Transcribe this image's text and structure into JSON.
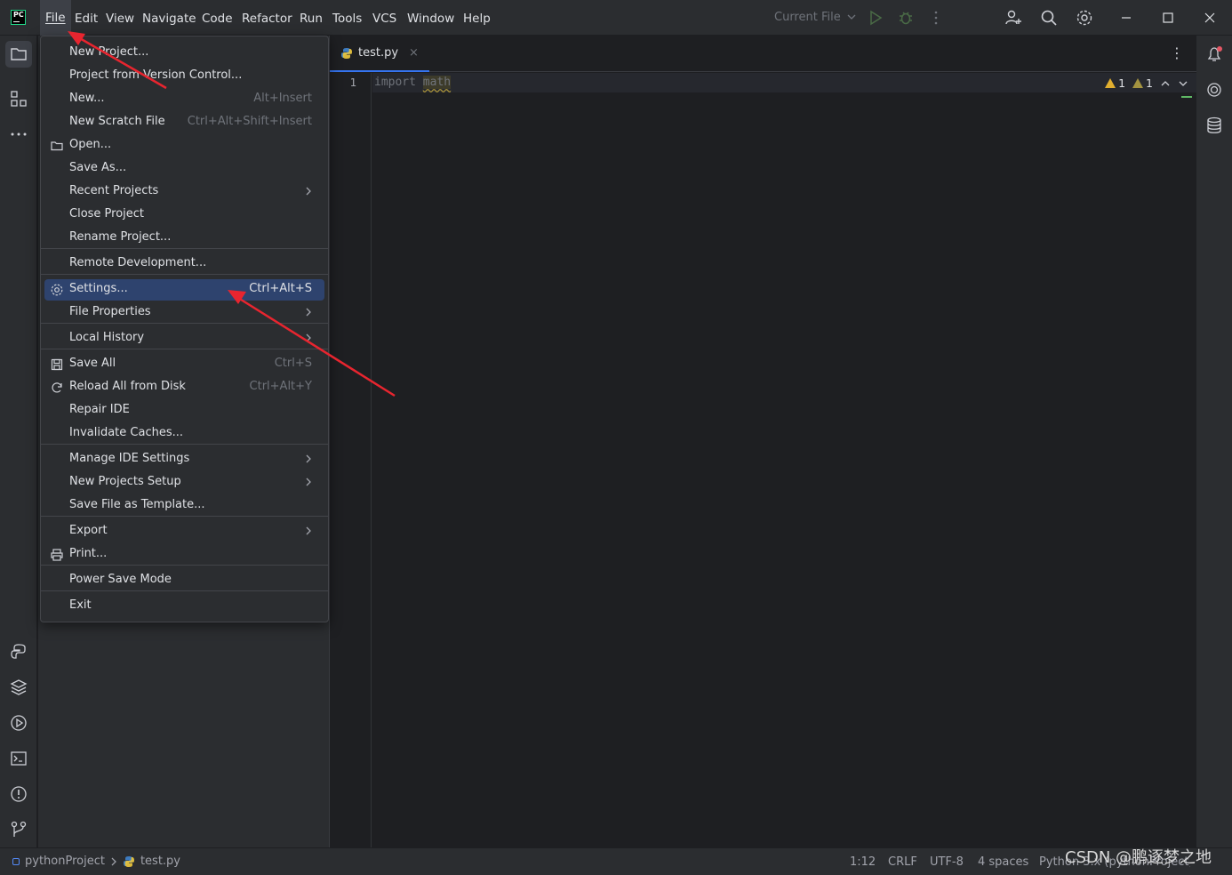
{
  "menubar": {
    "items": [
      {
        "id": "file",
        "label": "File",
        "mnemonic_index": 0
      },
      {
        "id": "edit",
        "label": "Edit"
      },
      {
        "id": "view",
        "label": "View"
      },
      {
        "id": "navigate",
        "label": "Navigate"
      },
      {
        "id": "code",
        "label": "Code"
      },
      {
        "id": "refactor",
        "label": "Refactor"
      },
      {
        "id": "run",
        "label": "Run"
      },
      {
        "id": "tools",
        "label": "Tools"
      },
      {
        "id": "vcs",
        "label": "VCS"
      },
      {
        "id": "window",
        "label": "Window"
      },
      {
        "id": "help",
        "label": "Help"
      }
    ]
  },
  "toolbar": {
    "run_config": "Current File",
    "icons": [
      "run-icon",
      "debug-icon",
      "more-vertical-icon",
      "add-user-icon",
      "search-icon",
      "settings-gear-icon"
    ]
  },
  "window_controls": [
    "minimize-icon",
    "maximize-icon",
    "close-icon"
  ],
  "file_menu": {
    "items": [
      {
        "label": "New Project...",
        "shortcut": "",
        "submenu": false
      },
      {
        "label": "Project from Version Control...",
        "shortcut": "",
        "submenu": false
      },
      {
        "label": "New...",
        "shortcut": "Alt+Insert",
        "submenu": false
      },
      {
        "label": "New Scratch File",
        "shortcut": "Ctrl+Alt+Shift+Insert",
        "submenu": false
      },
      {
        "label": "Open...",
        "shortcut": "",
        "submenu": false,
        "icon": "folder-icon"
      },
      {
        "label": "Save As...",
        "shortcut": "",
        "submenu": false
      },
      {
        "label": "Recent Projects",
        "shortcut": "",
        "submenu": true
      },
      {
        "label": "Close Project",
        "shortcut": "",
        "submenu": false
      },
      {
        "label": "Rename Project...",
        "shortcut": "",
        "submenu": false
      },
      {
        "label": "Remote Development...",
        "shortcut": "",
        "submenu": false
      },
      {
        "label": "Settings...",
        "shortcut": "Ctrl+Alt+S",
        "submenu": false,
        "icon": "gear-icon",
        "selected": true
      },
      {
        "label": "File Properties",
        "shortcut": "",
        "submenu": true
      },
      {
        "label": "Local History",
        "shortcut": "",
        "submenu": true
      },
      {
        "label": "Save All",
        "shortcut": "Ctrl+S",
        "submenu": false,
        "icon": "save-icon"
      },
      {
        "label": "Reload All from Disk",
        "shortcut": "Ctrl+Alt+Y",
        "submenu": false,
        "icon": "reload-icon"
      },
      {
        "label": "Repair IDE",
        "shortcut": "",
        "submenu": false
      },
      {
        "label": "Invalidate Caches...",
        "shortcut": "",
        "submenu": false
      },
      {
        "label": "Manage IDE Settings",
        "shortcut": "",
        "submenu": true
      },
      {
        "label": "New Projects Setup",
        "shortcut": "",
        "submenu": true
      },
      {
        "label": "Save File as Template...",
        "shortcut": "",
        "submenu": false
      },
      {
        "label": "Export",
        "shortcut": "",
        "submenu": true
      },
      {
        "label": "Print...",
        "shortcut": "",
        "submenu": false,
        "icon": "print-icon"
      },
      {
        "label": "Power Save Mode",
        "shortcut": "",
        "submenu": false
      },
      {
        "label": "Exit",
        "shortcut": "",
        "submenu": false
      }
    ]
  },
  "editor": {
    "tab_label": "test.py",
    "line_number": "1",
    "code_keyword": "import",
    "code_module": "math",
    "warnings_count": "1",
    "weak_warnings_count": "1"
  },
  "statusbar": {
    "project": "pythonProject",
    "file": "test.py",
    "position": "1:12",
    "line_separator": "CRLF",
    "encoding": "UTF-8",
    "indent": "4 spaces",
    "interpreter": "Python 3.x (pythonProject)"
  },
  "watermark": "CSDN @鹏逐梦之地",
  "colors": {
    "accent": "#3574f0",
    "selection": "#2e436e",
    "annotation_red": "#e8252f",
    "warning": "#e0ae2f"
  }
}
